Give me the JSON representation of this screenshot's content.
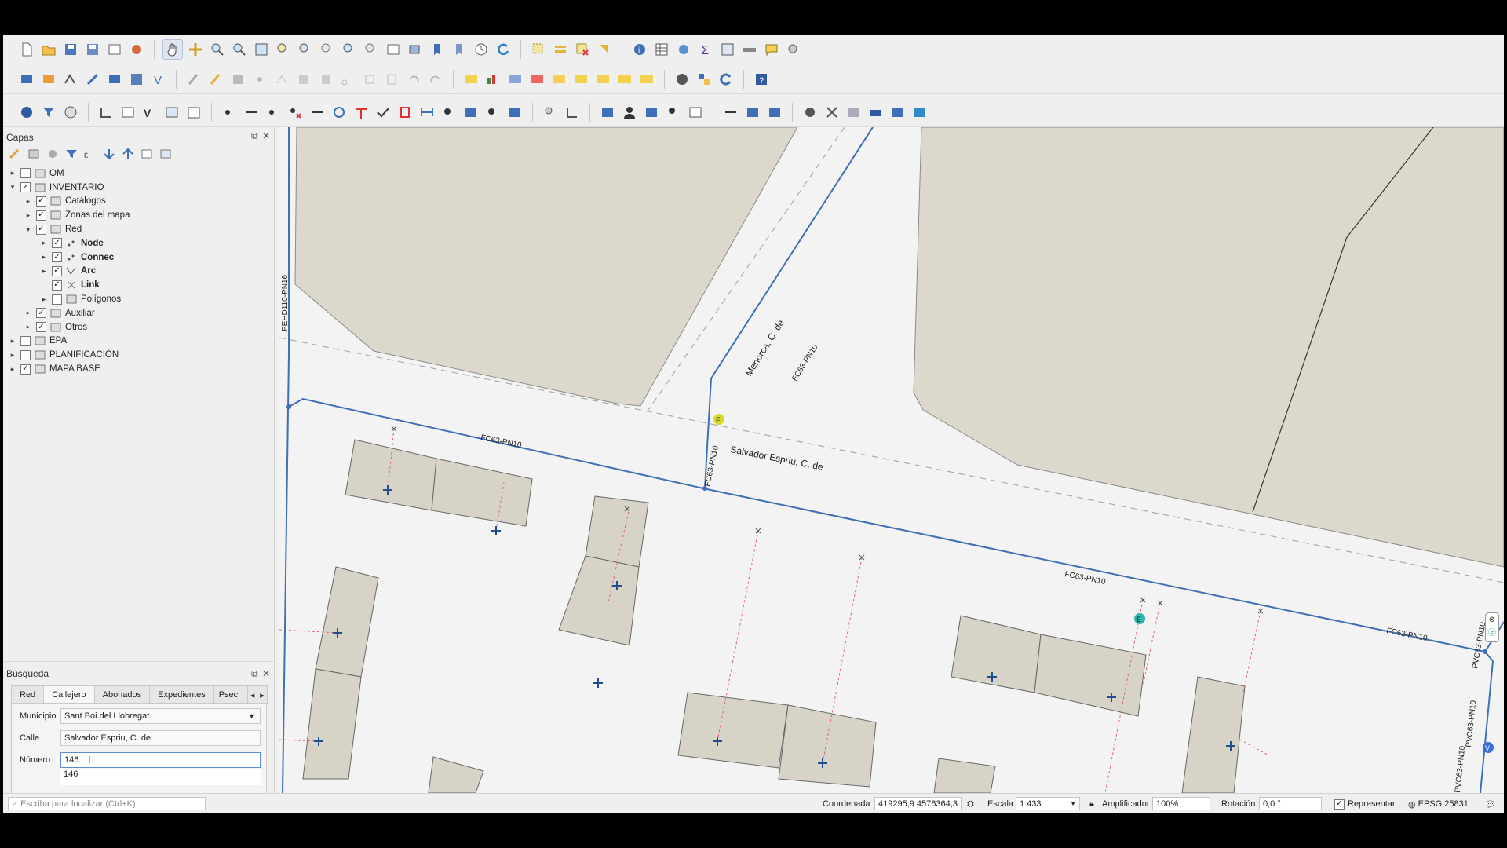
{
  "layers_panel": {
    "title": "Capas",
    "items": [
      {
        "label": "OM",
        "checked": false,
        "bold": false,
        "expanded": false
      },
      {
        "label": "INVENTARIO",
        "checked": true,
        "bold": false,
        "expanded": true
      },
      {
        "label": "Catálogos",
        "checked": true,
        "bold": false,
        "expanded": false
      },
      {
        "label": "Zonas del mapa",
        "checked": true,
        "bold": false,
        "expanded": false
      },
      {
        "label": "Red",
        "checked": true,
        "bold": false,
        "expanded": true
      },
      {
        "label": "Node",
        "checked": true,
        "bold": true,
        "expanded": false
      },
      {
        "label": "Connec",
        "checked": true,
        "bold": true,
        "expanded": false
      },
      {
        "label": "Arc",
        "checked": true,
        "bold": true,
        "expanded": false
      },
      {
        "label": "Link",
        "checked": true,
        "bold": true,
        "expanded": false
      },
      {
        "label": "Polígonos",
        "checked": false,
        "bold": false,
        "expanded": false
      },
      {
        "label": "Auxiliar",
        "checked": true,
        "bold": false,
        "expanded": false
      },
      {
        "label": "Otros",
        "checked": true,
        "bold": false,
        "expanded": false
      },
      {
        "label": "EPA",
        "checked": false,
        "bold": false,
        "expanded": false
      },
      {
        "label": "PLANIFICACIÓN",
        "checked": false,
        "bold": false,
        "expanded": false
      },
      {
        "label": "MAPA BASE",
        "checked": true,
        "bold": false,
        "expanded": false
      }
    ]
  },
  "search_panel": {
    "title": "Búsqueda",
    "tabs": [
      "Red",
      "Callejero",
      "Abonados",
      "Expedientes",
      "Psec"
    ],
    "active_tab": "Callejero",
    "municipio_label": "Municipio",
    "municipio_value": "Sant Boi del Llobregat",
    "calle_label": "Calle",
    "calle_value": "Salvador Espriu, C. de",
    "numero_label": "Número",
    "numero_value": "146",
    "suggestion": "146"
  },
  "map": {
    "street_labels": [
      "Menorca, C. de",
      "Salvador Espriu, C. de"
    ],
    "pipe_labels": [
      "FC63-PN10",
      "FC63-PN10",
      "FC63-PN10",
      "FC63-PN10",
      "FC63-PN10",
      "PEHD110-PN16",
      "PVC63-PN10",
      "PVC63-PN10",
      "PVC63-PN10"
    ],
    "node_markers": [
      "F",
      "E",
      "V"
    ]
  },
  "statusbar": {
    "locator_placeholder": "Escriba para localizar (Ctrl+K)",
    "coord_label": "Coordenada",
    "coord_value": "419295,9 4576364,3",
    "scale_label": "Escala",
    "scale_value": "1:433",
    "magnifier_label": "Amplificador",
    "magnifier_value": "100%",
    "rotation_label": "Rotación",
    "rotation_value": "0,0 °",
    "render_label": "Representar",
    "crs": "EPSG:25831"
  },
  "colors": {
    "building": "#d8d3c7",
    "block": "#ddd8cc",
    "pipe": "#3f6fb5",
    "link": "#e0627a",
    "node_f": "#d9d92a",
    "node_e": "#2fb8b2",
    "node_v": "#3f6fd6"
  }
}
